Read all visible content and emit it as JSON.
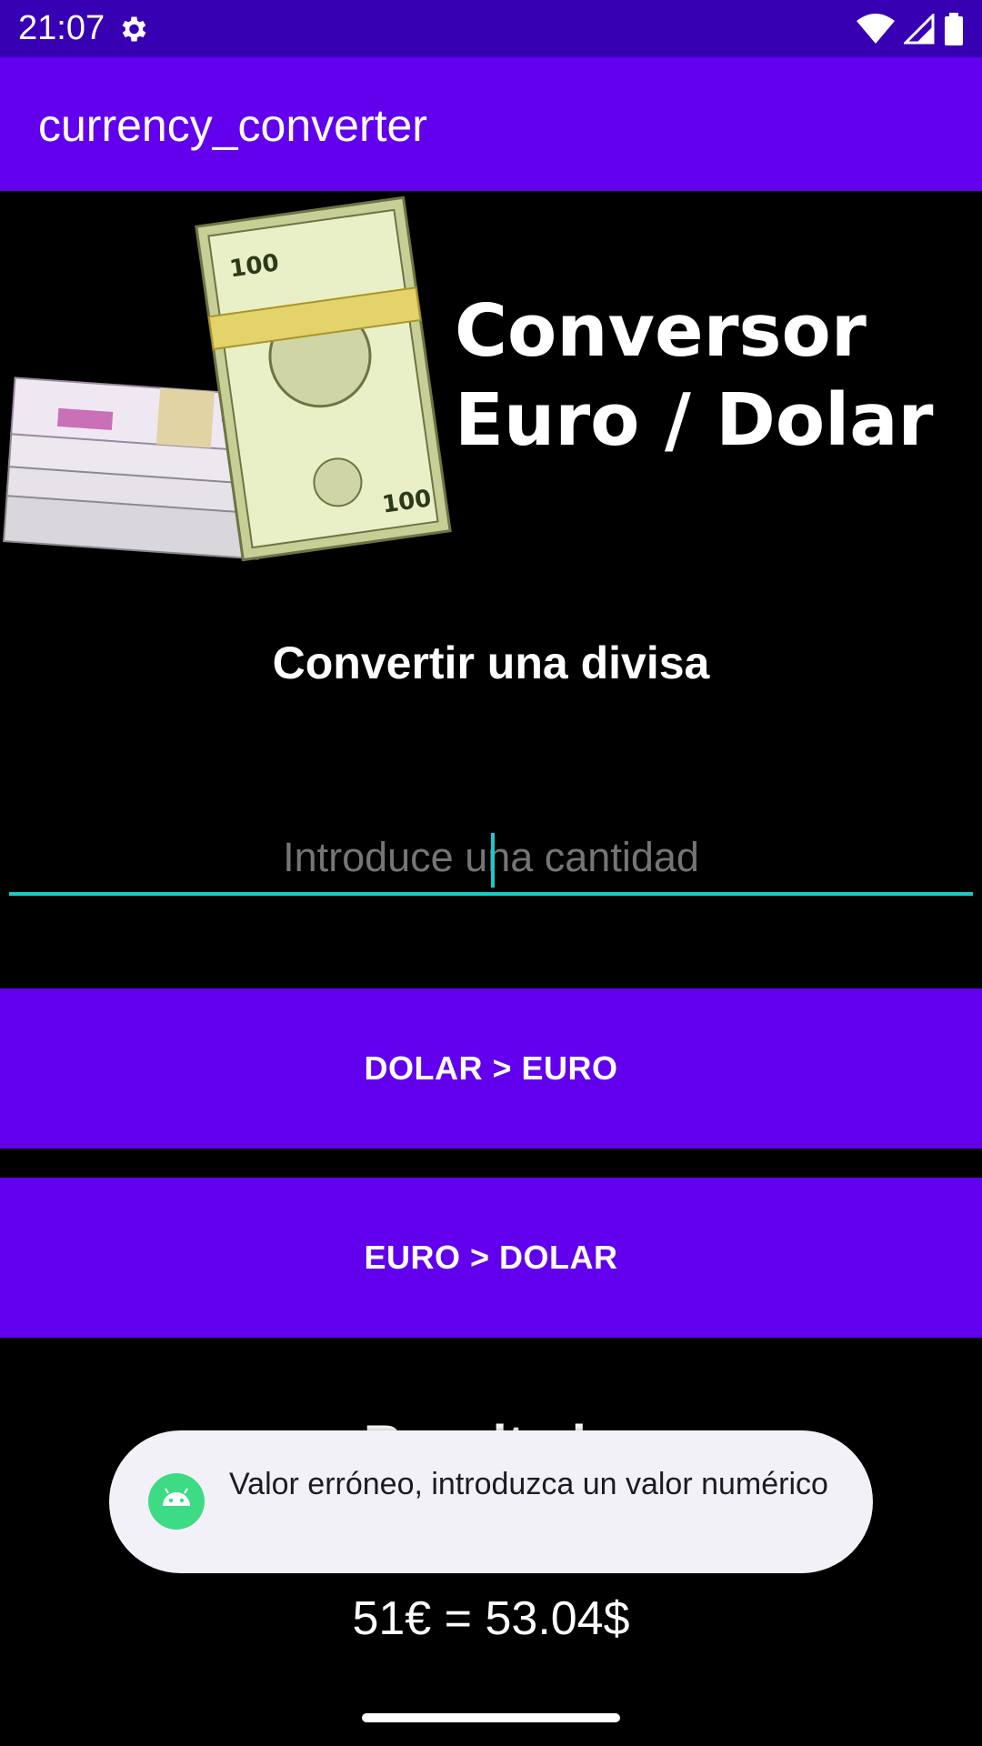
{
  "status": {
    "time": "21:07"
  },
  "app": {
    "title": "currency_converter"
  },
  "banner": {
    "title": "Conversor\nEuro / Dolar"
  },
  "converter": {
    "heading": "Convertir una divisa",
    "amount_placeholder": "Introduce una cantidad",
    "dollar_to_euro_label": "DOLAR > EURO",
    "euro_to_dollar_label": "EURO > DOLAR"
  },
  "result": {
    "heading": "Resultado",
    "value": "51€ = 53.04$"
  },
  "toast": {
    "message": "Valor erróneo, introduzca un valor numérico"
  },
  "colors": {
    "status_bar": "#3700B3",
    "primary": "#6200EE",
    "accent": "#1FC8C8",
    "toast_bg": "#F3F1F8"
  }
}
